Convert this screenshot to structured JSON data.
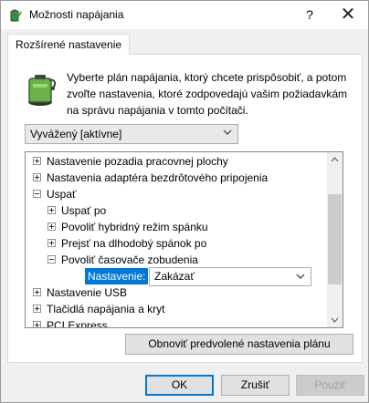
{
  "window": {
    "title": "Možnosti napájania",
    "help_label": "?",
    "close_label": "✕"
  },
  "tab": {
    "label": "Rozšírené nastavenie"
  },
  "description": "Vyberte plán napájania, ktorý chcete prispôsobiť, a potom zvoľte nastavenia, ktoré zodpovedajú vašim požiadavkám na správu napájania v tomto počítači.",
  "plan_select": {
    "value": "Vyvážený [aktívne]"
  },
  "tree": {
    "items": [
      {
        "label": "Nastavenie pozadia pracovnej plochy",
        "expander": "plus"
      },
      {
        "label": "Nastavenia adaptéra bezdrôtového pripojenia",
        "expander": "plus"
      },
      {
        "label": "Uspať",
        "expander": "minus"
      },
      {
        "label": "Uspať po",
        "expander": "plus"
      },
      {
        "label": "Povoliť hybridný režim spánku",
        "expander": "plus"
      },
      {
        "label": "Prejsť na dlhodobý spánok po",
        "expander": "plus"
      },
      {
        "label": "Povoliť časovače zobudenia",
        "expander": "minus"
      },
      {
        "label": "Nastavenie USB",
        "expander": "plus"
      },
      {
        "label": "Tlačidlá napájania a kryt",
        "expander": "plus"
      },
      {
        "label": "PCI Express",
        "expander": "plus"
      }
    ],
    "setting_label": "Nastavenie:",
    "setting_value": "Zakázať"
  },
  "restore_button": "Obnoviť predvolené nastavenia plánu",
  "buttons": {
    "ok": "OK",
    "cancel": "Zrušiť",
    "apply": "Použiť"
  },
  "colors": {
    "selection": "#0078d7",
    "panel": "#ffffff",
    "dialog": "#f0f0f0"
  },
  "icons": {
    "app": "power-options-icon",
    "battery": "battery-plan-icon"
  }
}
